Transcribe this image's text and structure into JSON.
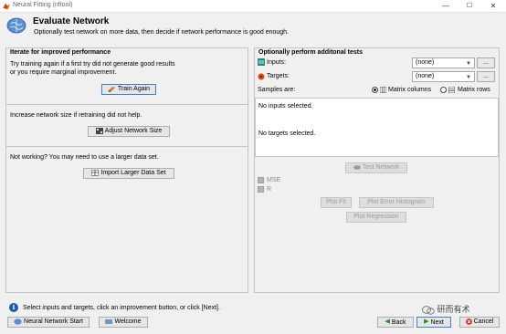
{
  "window": {
    "title": "Neural Fitting (nftool)",
    "controls": {
      "minimize": "—",
      "maximize": "☐",
      "close": "✕"
    }
  },
  "header": {
    "title": "Evaluate Network",
    "subtitle": "Optionally test network on more data, then decide if network performance is good enough."
  },
  "left_panel": {
    "title": "Iterate for improved performance",
    "sections": [
      {
        "text_line1": "Try training again if a first try did not generate good results",
        "text_line2": "or you require marginal improvement.",
        "button": "Train Again"
      },
      {
        "text_line1": "Increase network size if retraining did not help.",
        "button": "Adjust Network Size"
      },
      {
        "text_line1": "Not working? You may need to use a larger data set.",
        "button": "Import Larger Data Set"
      }
    ]
  },
  "right_panel": {
    "title": "Optionally perform additonal tests",
    "inputs": {
      "label": "Inputs:",
      "value": "(none)",
      "browse": "..."
    },
    "targets": {
      "label": "Targets:",
      "value": "(none)",
      "browse": "..."
    },
    "samples": {
      "label": "Samples are:",
      "option_columns": "Matrix columns",
      "option_rows": "Matrix rows",
      "selected": "columns"
    },
    "inputs_status": "No inputs selected.",
    "targets_status": "No targets selected.",
    "test_button": "Test Network",
    "metrics": [
      "MSE",
      "R"
    ],
    "plot_fit": "Plot Fit",
    "plot_error_histogram": "Plot Error Histogram",
    "plot_regression": "Plot Regression"
  },
  "status": {
    "message": "Select inputs and targets, click an improvement button, or click [Next]."
  },
  "footer": {
    "nn_start": "Neural Network Start",
    "welcome": "Welcome",
    "back": "Back",
    "next": "Next",
    "cancel": "Cancel"
  },
  "watermark": "研而有术",
  "colors": {
    "accent": "#3c7fd8",
    "info": "#1e5aa8",
    "cancel": "#cc2a1f",
    "next": "#2a8a2a"
  }
}
